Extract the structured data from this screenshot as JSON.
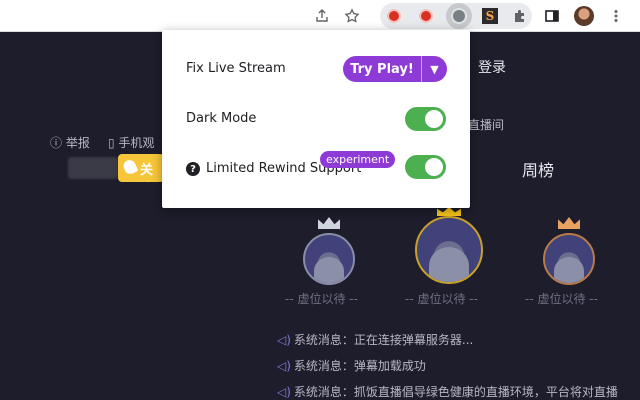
{
  "toolbar": {
    "icons": [
      "share-icon",
      "star-icon",
      "record-icon",
      "record-icon",
      "extension-active-icon",
      "s-extension-icon",
      "puzzle-icon",
      "sidebar-icon",
      "profile-avatar",
      "more-icon"
    ],
    "s_ext_letter": "S"
  },
  "page": {
    "login": "登录",
    "report": "举报",
    "phone": "手机观",
    "live_room": "直播间",
    "weekly": "周榜",
    "follow": "关注",
    "vacant_label": "-- 虚位以待 --",
    "messages": [
      "系统消息：正在连接弹幕服务器...",
      "系统消息：弹幕加载成功",
      "系统消息：抓饭直播倡导绿色健康的直播环境，平台将对直播"
    ],
    "crown_colors": {
      "second": "#d0d4dc",
      "first": "#f3c21c",
      "third": "#e8a063"
    }
  },
  "popup": {
    "fix_live_stream": "Fix Live Stream",
    "try_play": "Try Play!",
    "dark_mode": "Dark Mode",
    "dark_mode_on": true,
    "limited_rewind": "Limited Rewind Support",
    "limited_rewind_on": true,
    "experiment_badge": "experiment",
    "accent_color": "#8e3ad6",
    "toggle_color": "#4caf50"
  }
}
